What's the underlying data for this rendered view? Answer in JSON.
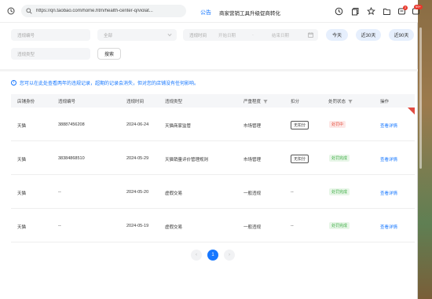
{
  "browser": {
    "url": "https://qn.taobao.com/home.htm/health-center-q/violat...",
    "announcement_tag": "公告",
    "announcement_title": "商家营销工具升级促商转化",
    "badges": [
      "2",
      "99+"
    ]
  },
  "filters": {
    "violation_id_placeholder": "违规编号",
    "all_label": "全部",
    "violation_time_label": "违规时间",
    "start_date": "开始日期",
    "end_date": "结束日期",
    "today": "今天",
    "last_30": "近30天",
    "last_90": "近90天",
    "violation_type_placeholder": "违规类型",
    "search": "搜索"
  },
  "notice": "您可以在此处查看两年的违规记录，超期的记录会消失，但对您的店铺没有任何影响。",
  "table": {
    "headers": [
      "店铺身份",
      "违规编号",
      "违规时间",
      "违规类型",
      "严重程度",
      "扣分",
      "处罚状态",
      "操作"
    ],
    "rows": [
      {
        "identity": "天猫",
        "id": "38887456208",
        "time": "2024-06-24",
        "type": "天猫商家监管",
        "severity": "市场管理",
        "points": "无扣分",
        "status": "处罚中",
        "status_kind": "red",
        "action": "查看详情"
      },
      {
        "identity": "天猫",
        "id": "38384868510",
        "time": "2024-05-29",
        "type": "天猫销量评价管理规则",
        "severity": "市场管理",
        "points": "无扣分",
        "status": "处罚完成",
        "status_kind": "green",
        "action": "查看详情"
      },
      {
        "identity": "天猫",
        "id": "--",
        "time": "2024-05-20",
        "type": "虚假交易",
        "severity": "一般违规",
        "points": "--",
        "status": "处罚完成",
        "status_kind": "green",
        "action": "查看详情"
      },
      {
        "identity": "天猫",
        "id": "--",
        "time": "2024-05-19",
        "type": "虚假交易",
        "severity": "一般违规",
        "points": "--",
        "status": "处罚完成",
        "status_kind": "green",
        "action": "查看详情"
      }
    ]
  },
  "pagination": {
    "prev": "‹",
    "current": "1",
    "next": "›"
  }
}
